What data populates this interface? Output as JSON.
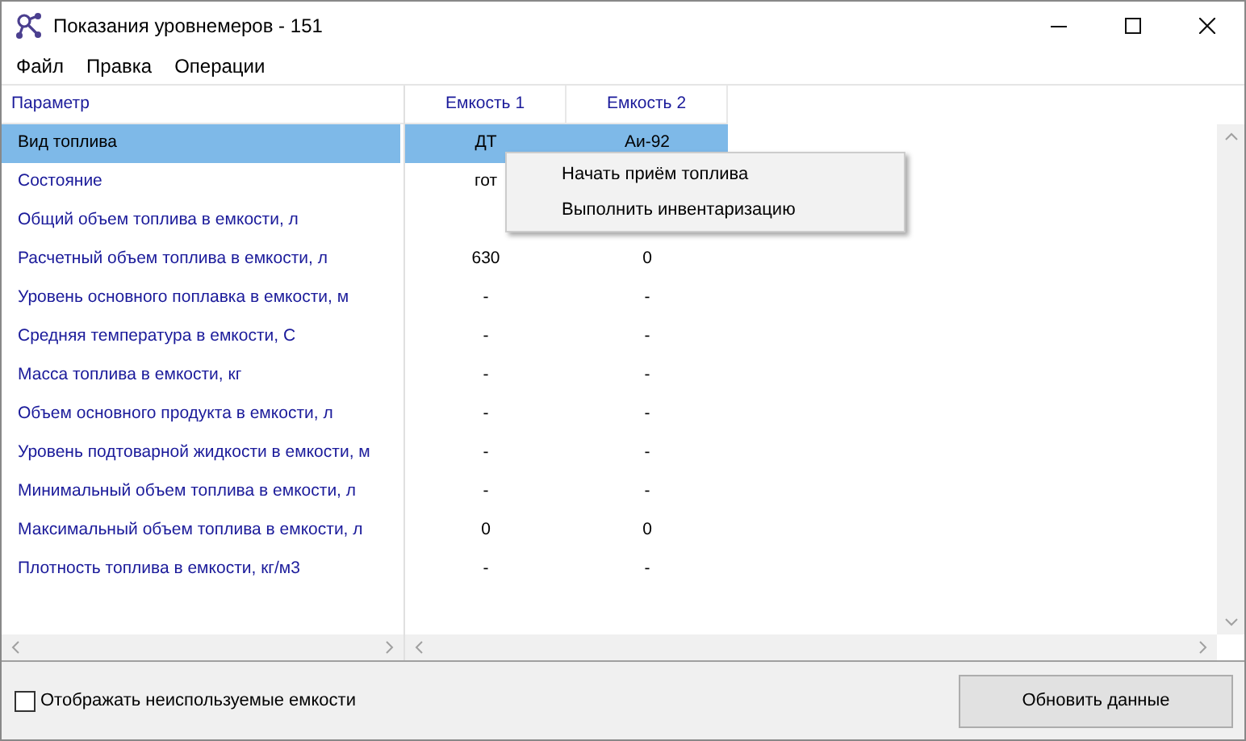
{
  "window": {
    "title": "Показания уровнемеров - 151"
  },
  "menu_bar": [
    "Файл",
    "Правка",
    "Операции"
  ],
  "table": {
    "columns": [
      "Параметр",
      "Емкость 1",
      "Емкость 2"
    ],
    "rows": [
      {
        "label": "Вид топлива",
        "values": [
          "ДТ",
          "Аи-92"
        ],
        "selected": true
      },
      {
        "label": "Состояние",
        "values": [
          "гот"
        ],
        "selected": false
      },
      {
        "label": "Общий объем топлива в емкости, л",
        "values": [],
        "selected": false
      },
      {
        "label": "Расчетный объем топлива в емкости, л",
        "values": [
          "630",
          "0"
        ],
        "selected": false
      },
      {
        "label": "Уровень основного поплавка в емкости, м",
        "values": [
          "-",
          "-"
        ],
        "selected": false
      },
      {
        "label": "Средняя температура в емкости, С",
        "values": [
          "-",
          "-"
        ],
        "selected": false
      },
      {
        "label": "Масса топлива в емкости, кг",
        "values": [
          "-",
          "-"
        ],
        "selected": false
      },
      {
        "label": "Объем основного продукта в емкости, л",
        "values": [
          "-",
          "-"
        ],
        "selected": false
      },
      {
        "label": "Уровень подтоварной жидкости в емкости, м",
        "values": [
          "-",
          "-"
        ],
        "selected": false
      },
      {
        "label": "Минимальный объем топлива в емкости, л",
        "values": [
          "-",
          "-"
        ],
        "selected": false
      },
      {
        "label": "Максимальный объем топлива в емкости, л",
        "values": [
          "0",
          "0"
        ],
        "selected": false
      },
      {
        "label": "Плотность топлива в емкости, кг/м3",
        "values": [
          "-",
          "-"
        ],
        "selected": false
      }
    ]
  },
  "context_menu": [
    "Начать приём топлива",
    "Выполнить инвентаризацию"
  ],
  "show_unused": {
    "label": "Отображать неиспользуемые емкости",
    "checked": false
  },
  "refresh_button": "Обновить данные"
}
